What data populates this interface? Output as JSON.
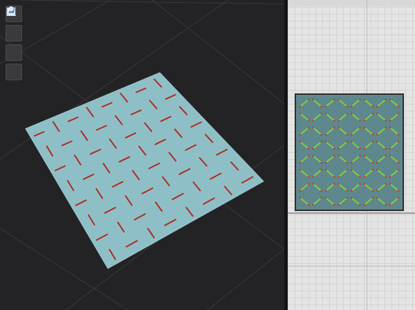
{
  "toolbar": {
    "items": [
      {
        "name": "avatar-garment-icon"
      },
      {
        "name": "avatar-icon"
      },
      {
        "name": "texture-icon"
      },
      {
        "name": "user-icon"
      }
    ]
  },
  "colors": {
    "viewport_bg": "#232325",
    "fabric_3d": "#8fbfc6",
    "stitch_3d": "#b02a1e",
    "pattern_piece": "#5f878e",
    "stitch_2d": "#7ed33a",
    "canvas_2d": "#e4e4e4"
  },
  "scene": {
    "fabric_piece": "fabric-piece-3d",
    "pattern_piece": "pattern-piece-2d"
  }
}
